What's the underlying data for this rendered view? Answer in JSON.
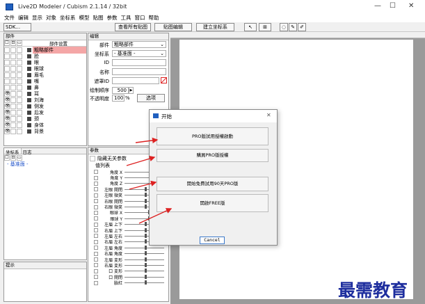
{
  "window": {
    "title": "Live2D Modeler / Cubism 2.1.14 / 32bit",
    "controls": [
      "—",
      "☐",
      "✕"
    ]
  },
  "menu": [
    "文件",
    "编辑",
    "显示",
    "对象",
    "坐标系",
    "模型",
    "贴图",
    "参数",
    "工具",
    "窗口",
    "帮助"
  ],
  "toolbar": {
    "sdk_select": "SDK...",
    "view_all_textures": "查看所有贴图",
    "texture_edit": "贴图编辑",
    "create_coordinate": "建立坐标系"
  },
  "parts_panel": {
    "title": "部件",
    "header_right": "部件设置",
    "items": [
      "粗略部件",
      "脸",
      "眼",
      "眼球",
      "眉毛",
      "嘴",
      "鼻",
      "耳",
      "刘海",
      "侧发",
      "后发",
      "颈",
      "身体",
      "背景"
    ]
  },
  "edit_panel": {
    "title": "编辑",
    "part_label": "部件",
    "part_value": "粗略部件",
    "coord_label": "坐标系",
    "coord_value": "- 基准面 -",
    "id_label": "ID",
    "name_label": "名称",
    "mask_label": "遮罩ID",
    "draw_order_label": "绘制顺序",
    "draw_order_value": "500",
    "opacity_label": "不透明度",
    "opacity_value": "100",
    "opacity_unit": "%",
    "options_button": "选项"
  },
  "coord_panel": {
    "tabs": [
      "坐标系",
      "日志"
    ],
    "item": "- 基准面 -"
  },
  "hint_panel": {
    "title": "提示"
  },
  "params_panel": {
    "title": "参数",
    "hide_unrelated": "隐藏无关参数",
    "list_label": "值列表",
    "params": [
      "角度 X",
      "角度 Y",
      "角度 Z",
      "左眼 開閉",
      "左眼 微笑",
      "右眼 開閉",
      "右眼 微笑",
      "眼球 X",
      "眼球 Y",
      "左眉 上下",
      "右眉 上下",
      "左眉 左右",
      "右眉 左右",
      "左眉 角度",
      "右眉 角度",
      "左眉 変形",
      "右眉 変形",
      "口 変形",
      "口 開閉",
      "臉紅"
    ]
  },
  "dialog": {
    "title": "开始",
    "close": "✕",
    "buttons": [
      "PRO版試用授權啟動",
      "購買PRO版授權",
      "開始免費試用90天PRO版",
      "開啟FREE版"
    ],
    "cancel": "Cancel"
  },
  "watermark": "最需教育",
  "colors": {
    "selected_part": "#f4a6a6",
    "arrow": "#dd2222",
    "watermark": "#1e2e9e",
    "cancel_border": "#3b78c9"
  }
}
